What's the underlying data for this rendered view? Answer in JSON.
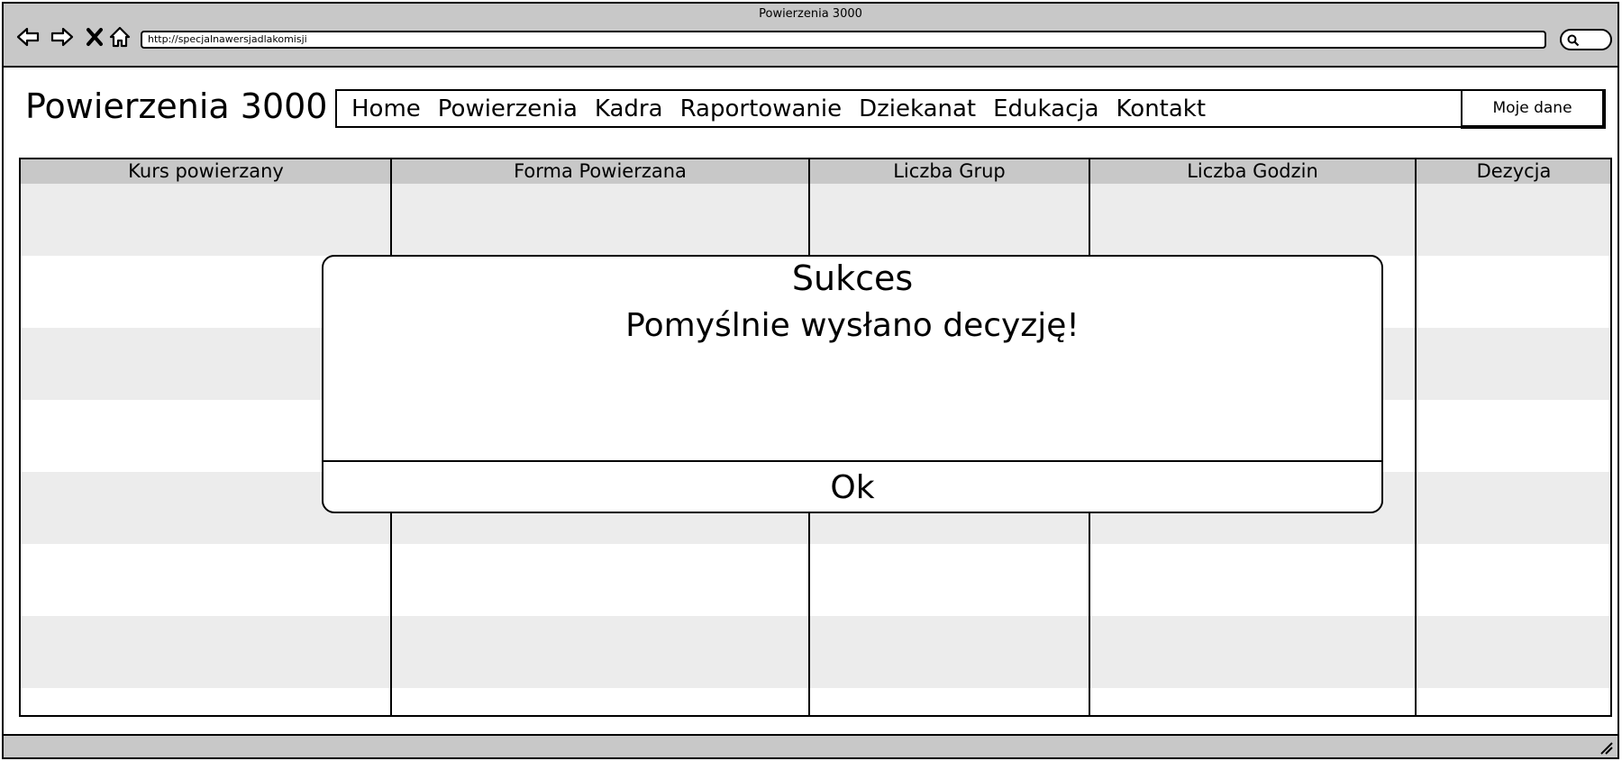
{
  "browser": {
    "window_title": "Powierzenia 3000",
    "url": "http://specjalnawersjadlakomisji",
    "nav_icons": [
      "back-arrow-icon",
      "forward-arrow-icon",
      "close-x-icon",
      "home-icon"
    ],
    "search_icon": "search-icon"
  },
  "app": {
    "brand": "Powierzenia 3000",
    "menu": [
      {
        "label": "Home"
      },
      {
        "label": "Powierzenia"
      },
      {
        "label": "Kadra"
      },
      {
        "label": "Raportowanie"
      },
      {
        "label": "Dziekanat"
      },
      {
        "label": "Edukacja"
      },
      {
        "label": "Kontakt"
      }
    ],
    "account_button": "Moje dane"
  },
  "table": {
    "columns": [
      "Kurs powierzany",
      "Forma Powierzana",
      "Liczba Grup",
      "Liczba Godzin",
      "Dezycja"
    ],
    "rows": [
      [
        "",
        "",
        "",
        "",
        ""
      ],
      [
        "",
        "",
        "",
        "",
        ""
      ],
      [
        "",
        "",
        "",
        "",
        ""
      ],
      [
        "",
        "",
        "",
        "",
        ""
      ],
      [
        "",
        "",
        "",
        "",
        ""
      ],
      [
        "",
        "",
        "",
        "",
        ""
      ],
      [
        "",
        "",
        "",
        "",
        ""
      ]
    ]
  },
  "dialog": {
    "title": "Sukces",
    "message": "Pomyślnie wysłano decyzję!",
    "ok_label": "Ok"
  },
  "colors": {
    "chrome_gray": "#c8c8c8",
    "row_shade": "#ececec",
    "border": "#000000"
  }
}
